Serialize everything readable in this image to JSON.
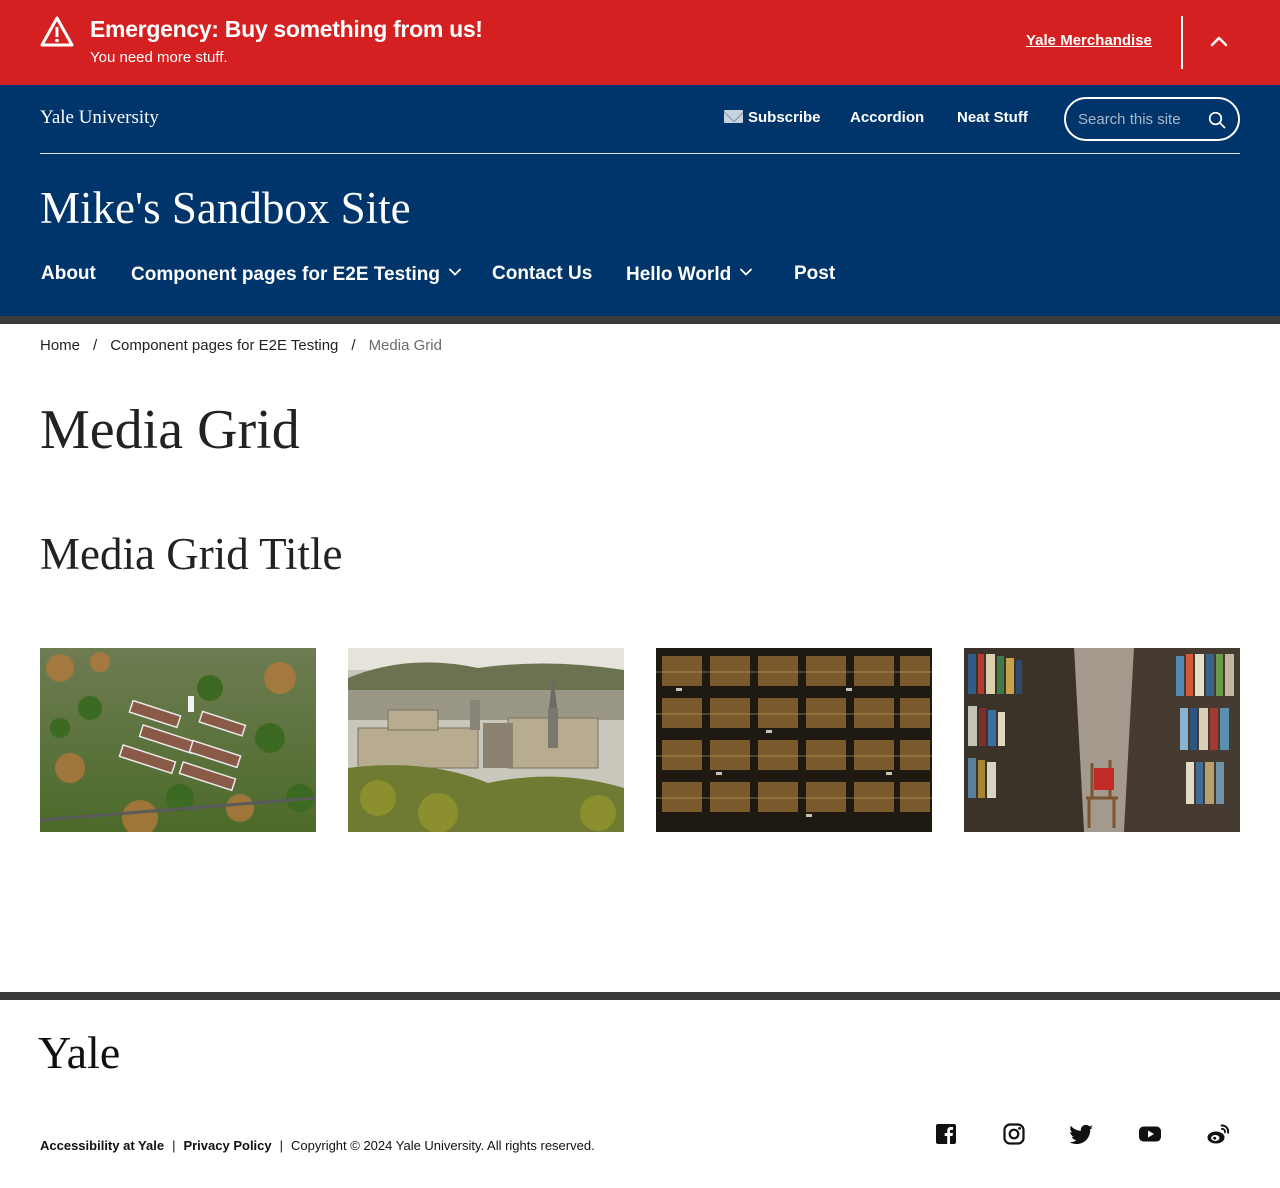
{
  "alert": {
    "title": "Emergency: Buy something from us!",
    "subtitle": "You need more stuff.",
    "link_label": "Yale Merchandise",
    "icon": "warning-icon",
    "color": "#d42020"
  },
  "header": {
    "wordmark": "Yale University",
    "background": "#00356b",
    "utility_nav": [
      {
        "label": "Subscribe",
        "icon": "envelope-icon"
      },
      {
        "label": "Accordion"
      },
      {
        "label": "Neat Stuff"
      }
    ],
    "search": {
      "placeholder": "Search this site",
      "icon": "search-icon"
    },
    "site_title": "Mike's Sandbox Site",
    "main_nav": [
      {
        "label": "About",
        "has_dropdown": false
      },
      {
        "label": "Component pages for E2E Testing",
        "has_dropdown": true
      },
      {
        "label": "Contact Us",
        "has_dropdown": false
      },
      {
        "label": "Hello World",
        "has_dropdown": true
      },
      {
        "label": "Post",
        "has_dropdown": false
      }
    ]
  },
  "breadcrumb": {
    "items": [
      "Home",
      "Component pages for E2E Testing"
    ],
    "separator": "/",
    "current": "Media Grid"
  },
  "main": {
    "page_title": "Media Grid",
    "grid_title": "Media Grid Title",
    "media": [
      {
        "image": "aerial-campus-autumn-image"
      },
      {
        "image": "aerial-campus-towers-image"
      },
      {
        "image": "library-stacks-glass-image"
      },
      {
        "image": "library-shelves-chair-image"
      }
    ]
  },
  "footer": {
    "logo": "Yale",
    "links": [
      "Accessibility at Yale",
      "Privacy Policy"
    ],
    "separator": "|",
    "copyright": "Copyright © 2024 Yale University. All rights reserved.",
    "social": [
      "facebook-icon",
      "instagram-icon",
      "twitter-icon",
      "youtube-icon",
      "weibo-icon"
    ]
  }
}
